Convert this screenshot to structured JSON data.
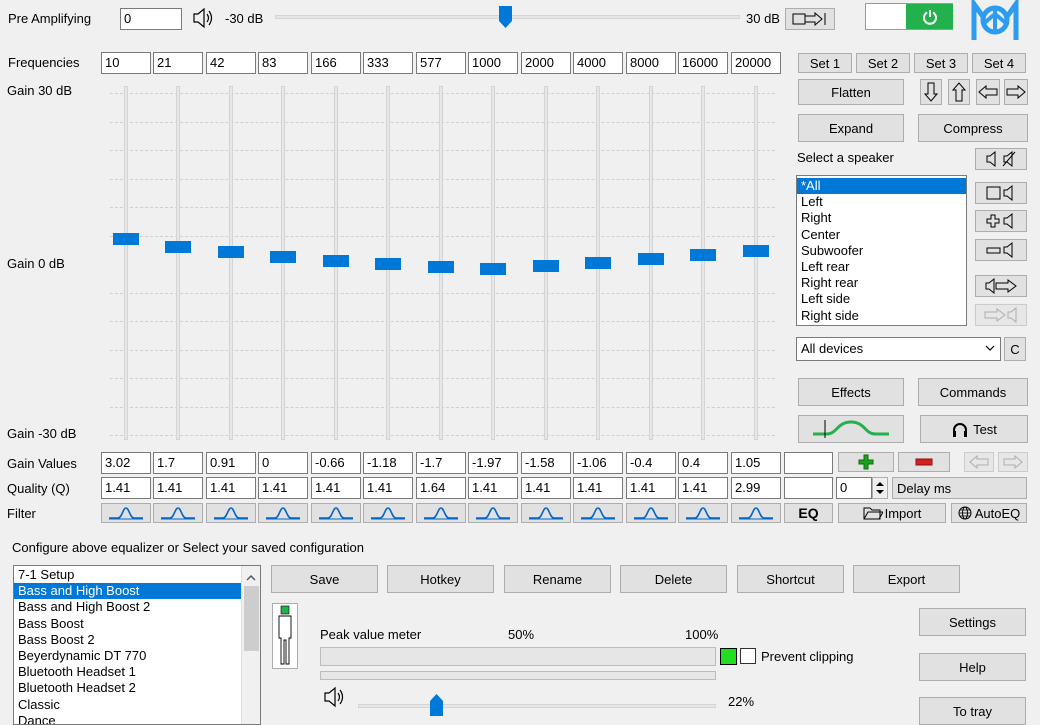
{
  "preamp": {
    "label": "Pre Amplifying",
    "value": "0",
    "min_label": "-30 dB",
    "max_label": "30 dB"
  },
  "labels": {
    "frequencies": "Frequencies",
    "gain_top": "Gain 30 dB",
    "gain_mid": "Gain 0 dB",
    "gain_bottom": "Gain -30 dB",
    "gain_values": "Gain Values",
    "quality": "Quality (Q)",
    "filter": "Filter"
  },
  "bands": [
    {
      "freq": "10",
      "gain": "3.02",
      "q": "1.41"
    },
    {
      "freq": "21",
      "gain": "1.7",
      "q": "1.41"
    },
    {
      "freq": "42",
      "gain": "0.91",
      "q": "1.41"
    },
    {
      "freq": "83",
      "gain": "0",
      "q": "1.41"
    },
    {
      "freq": "166",
      "gain": "-0.66",
      "q": "1.41"
    },
    {
      "freq": "333",
      "gain": "-1.18",
      "q": "1.41"
    },
    {
      "freq": "577",
      "gain": "-1.7",
      "q": "1.64"
    },
    {
      "freq": "1000",
      "gain": "-1.97",
      "q": "1.41"
    },
    {
      "freq": "2000",
      "gain": "-1.58",
      "q": "1.41"
    },
    {
      "freq": "4000",
      "gain": "-1.06",
      "q": "1.41"
    },
    {
      "freq": "8000",
      "gain": "-0.4",
      "q": "1.41"
    },
    {
      "freq": "16000",
      "gain": "0.4",
      "q": "1.41"
    },
    {
      "freq": "20000",
      "gain": "1.05",
      "q": "2.99"
    }
  ],
  "sets": [
    "Set 1",
    "Set 2",
    "Set 3",
    "Set 4"
  ],
  "buttons": {
    "flatten": "Flatten",
    "expand": "Expand",
    "compress": "Compress",
    "effects": "Effects",
    "commands": "Commands",
    "test": "Test",
    "delay_unit": "Delay ms",
    "delay_value": "0",
    "eq": "EQ",
    "import": "Import",
    "autoeq": "AutoEQ",
    "c": "C"
  },
  "speaker": {
    "label": "Select a speaker",
    "items": [
      "*All",
      "Left",
      "Right",
      "Center",
      "Subwoofer",
      "Left rear",
      "Right rear",
      "Left side",
      "Right side"
    ],
    "selected": 0,
    "device": "All devices"
  },
  "config": {
    "label": "Configure above equalizer or Select your saved configuration",
    "items": [
      "7-1 Setup",
      "Bass and High Boost",
      "Bass and High Boost 2",
      "Bass Boost",
      "Bass Boost 2",
      "Beyerdynamic DT 770",
      "Bluetooth Headset 1",
      "Bluetooth Headset 2",
      "Classic",
      "Dance"
    ],
    "selected": 1,
    "actions": [
      "Save",
      "Hotkey",
      "Rename",
      "Delete",
      "Shortcut",
      "Export"
    ]
  },
  "meter": {
    "label": "Peak value meter",
    "mid": "50%",
    "max": "100%",
    "prevent": "Prevent clipping",
    "volume_label": "22%",
    "volume": 0.22
  },
  "side": {
    "settings": "Settings",
    "help": "Help",
    "tray": "To tray"
  },
  "colors": {
    "accent": "#0078d7",
    "power": "#22b14c",
    "green": "#1fa01f",
    "red": "#d42020"
  }
}
